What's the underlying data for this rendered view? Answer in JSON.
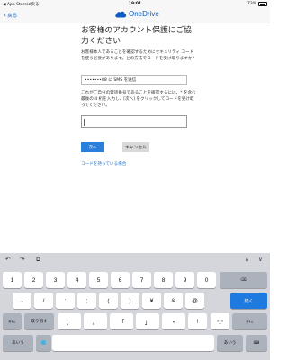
{
  "status_bar": {
    "back_app": "◀ App Storeに戻る",
    "time": "19:01",
    "battery": "73%"
  },
  "nav": {
    "back_label": "戻る",
    "brand": "OneDrive"
  },
  "main": {
    "title": "お客様のアカウント保護にご協力ください",
    "description": "お客様本人であることを確認するためにセキュリティ コードを使う必要があります。どの方法でコードを受け取りますか?",
    "method_selected": "•••••••88 に SMS を送信",
    "verify_text": "これがご自分の電話番号であることを確認するには、* を含む最後の 4 桁を入力し、[次へ] をクリックしてコードを受け取ってください。",
    "code_input_value": "",
    "next_label": "次へ",
    "cancel_label": "キャンセル",
    "no_code_link": "コードを持っている場合"
  },
  "keyboard": {
    "toolbar": {
      "undo": "↶",
      "redo": "↷",
      "paste": "⧉",
      "up": "∧",
      "down": "∨"
    },
    "row1": [
      "1",
      "2",
      "3",
      "4",
      "5",
      "6",
      "7",
      "8",
      "9",
      "0"
    ],
    "row2": [
      "-",
      "/",
      ":",
      ";",
      "(",
      ")",
      "¥",
      "&",
      "@"
    ],
    "return_label": "続く",
    "row3_left": "#+=",
    "undo_label": "取り消す",
    "row3": [
      "、",
      "。",
      "「",
      "」",
      "・",
      "!"
    ],
    "kaomoji": "^_^",
    "row3_right": "#+=",
    "abc_label": "あいう",
    "globe": "🌐",
    "mic": "🎤",
    "space": "",
    "abc_right": "あいう",
    "hide": "⌨"
  },
  "colors": {
    "accent": "#1d6fd1",
    "primary_button": "#2a7fdc",
    "keyboard_bg": "#d4d6dc"
  }
}
